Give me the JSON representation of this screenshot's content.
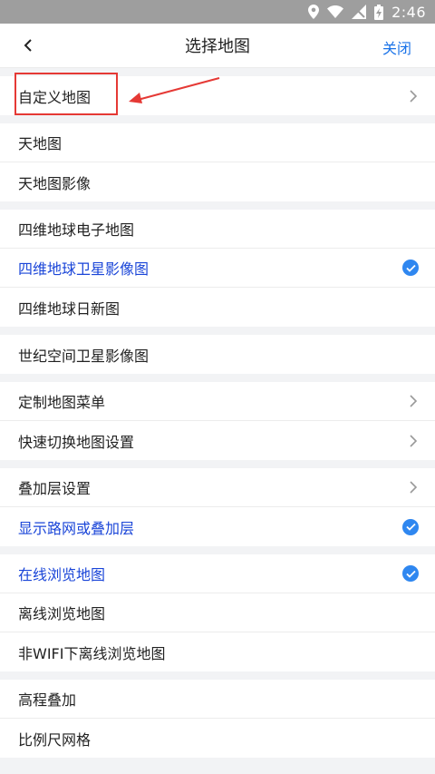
{
  "status": {
    "time": "2:46"
  },
  "header": {
    "title": "选择地图",
    "close_label": "关闭"
  },
  "groups": [
    {
      "items": [
        {
          "label": "自定义地图",
          "trailing": "chevron"
        }
      ]
    },
    {
      "items": [
        {
          "label": "天地图"
        },
        {
          "label": "天地图影像"
        }
      ]
    },
    {
      "items": [
        {
          "label": "四维地球电子地图"
        },
        {
          "label": "四维地球卫星影像图",
          "selected": true
        },
        {
          "label": "四维地球日新图"
        }
      ]
    },
    {
      "items": [
        {
          "label": "世纪空间卫星影像图"
        }
      ]
    },
    {
      "items": [
        {
          "label": "定制地图菜单",
          "trailing": "chevron"
        },
        {
          "label": "快速切换地图设置",
          "trailing": "chevron"
        }
      ]
    },
    {
      "items": [
        {
          "label": "叠加层设置",
          "trailing": "chevron"
        },
        {
          "label": "显示路网或叠加层",
          "selected": true
        }
      ]
    },
    {
      "items": [
        {
          "label": "在线浏览地图",
          "selected": true
        },
        {
          "label": "离线浏览地图"
        },
        {
          "label": "非WIFI下离线浏览地图"
        }
      ]
    },
    {
      "items": [
        {
          "label": "高程叠加"
        },
        {
          "label": "比例尺网格"
        }
      ]
    }
  ],
  "colors": {
    "accent": "#1a73e8",
    "selected_text": "#1a45d8",
    "annotation": "#e53935"
  }
}
